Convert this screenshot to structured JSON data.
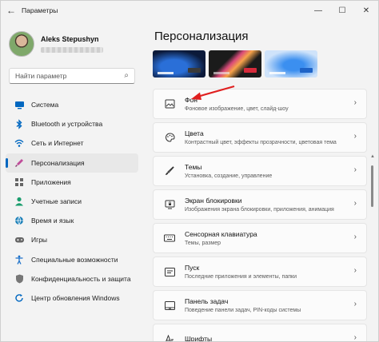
{
  "window": {
    "title": "Параметры",
    "back_icon": "back-arrow-icon"
  },
  "profile": {
    "name": "Aleks Stepushyn"
  },
  "search": {
    "placeholder": "Найти параметр"
  },
  "nav": {
    "items": [
      {
        "label": "Система",
        "icon": "monitor-icon",
        "color": "#0067c0"
      },
      {
        "label": "Bluetooth и устройства",
        "icon": "bluetooth-icon",
        "color": "#0067c0"
      },
      {
        "label": "Сеть и Интернет",
        "icon": "network-icon",
        "color": "#0067c0"
      },
      {
        "label": "Персонализация",
        "icon": "brush-icon",
        "color": "#c04d9a",
        "active": true
      },
      {
        "label": "Приложения",
        "icon": "apps-icon",
        "color": "#555555"
      },
      {
        "label": "Учетные записи",
        "icon": "person-icon",
        "color": "#1a9d6d"
      },
      {
        "label": "Время и язык",
        "icon": "globe-icon",
        "color": "#1a7fb8"
      },
      {
        "label": "Игры",
        "icon": "gamepad-icon",
        "color": "#666666"
      },
      {
        "label": "Специальные возможности",
        "icon": "accessibility-icon",
        "color": "#1a6fc9"
      },
      {
        "label": "Конфиденциальность и защита",
        "icon": "shield-icon",
        "color": "#666666"
      },
      {
        "label": "Центр обновления Windows",
        "icon": "update-icon",
        "color": "#0067c0"
      }
    ]
  },
  "main": {
    "title": "Персонализация",
    "cards": [
      {
        "title": "Фон",
        "subtitle": "Фоновое изображение, цвет, слайд-шоу",
        "icon": "image-icon"
      },
      {
        "title": "Цвета",
        "subtitle": "Контрастный цвет, эффекты прозрачности, цветовая тема",
        "icon": "palette-icon"
      },
      {
        "title": "Темы",
        "subtitle": "Установка, создание, управление",
        "icon": "brush-icon"
      },
      {
        "title": "Экран блокировки",
        "subtitle": "Изображения экрана блокировки, приложения, анимация",
        "icon": "lock-screen-icon"
      },
      {
        "title": "Сенсорная клавиатура",
        "subtitle": "Темы, размер",
        "icon": "keyboard-icon"
      },
      {
        "title": "Пуск",
        "subtitle": "Последние приложения и элементы, папки",
        "icon": "start-icon"
      },
      {
        "title": "Панель задач",
        "subtitle": "Поведение панели задач, PIN-коды системы",
        "icon": "taskbar-icon"
      },
      {
        "title": "Шрифты",
        "subtitle": "",
        "icon": "font-icon"
      }
    ]
  },
  "accent_color": "#0067c0",
  "annotation_arrow_color": "#e02020"
}
